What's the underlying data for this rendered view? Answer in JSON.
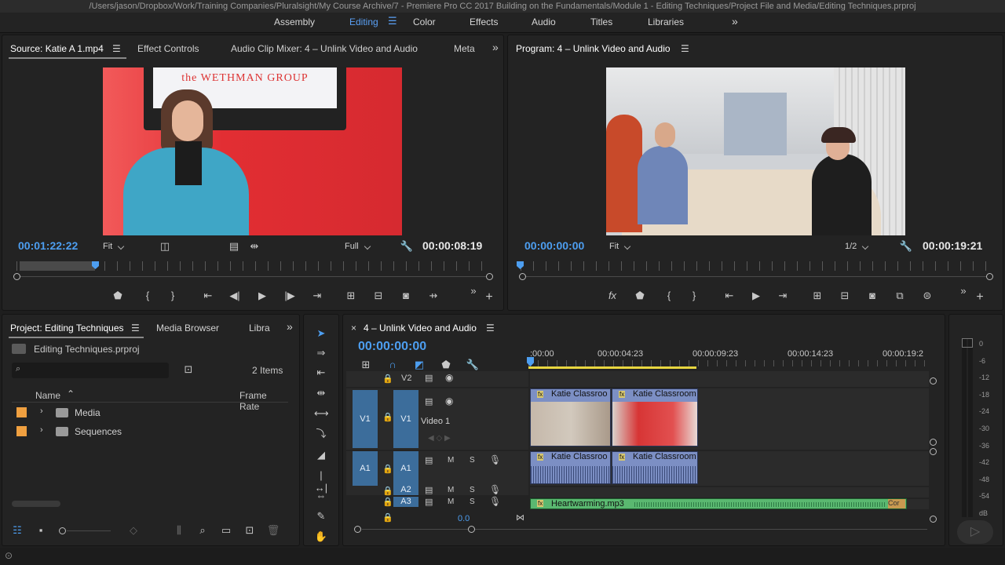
{
  "titlebar": {
    "path": "/Users/jason/Dropbox/Work/Training Companies/Pluralsight/My Course Archive/7 - Premiere Pro CC 2017 Building on the Fundamentals/Module 1 - Editing Techniques/Project File and Media/Editing Techniques.prproj"
  },
  "workspaces": {
    "items": [
      "Assembly",
      "Editing",
      "Color",
      "Effects",
      "Audio",
      "Titles",
      "Libraries"
    ],
    "active": "Editing",
    "more": "»"
  },
  "source": {
    "tabs": [
      "Source: Katie A 1.mp4",
      "Effect Controls",
      "Audio Clip Mixer: 4 – Unlink Video and Audio",
      "Meta"
    ],
    "overflow": "»",
    "timecode_current": "00:01:22:22",
    "fit": "Fit",
    "resolution": "Full",
    "timecode_duration": "00:00:08:19",
    "video_sign": "the WETHMAN GROUP"
  },
  "program": {
    "tab": "Program: 4 – Unlink Video and Audio",
    "timecode_current": "00:00:00:00",
    "fit": "Fit",
    "resolution": "1/2",
    "timecode_duration": "00:00:19:21"
  },
  "project": {
    "tabs": [
      "Project: Editing Techniques",
      "Media Browser",
      "Libra"
    ],
    "overflow": "»",
    "file": "Editing Techniques.prproj",
    "search_placeholder": "",
    "items_count": "2 Items",
    "col_name": "Name",
    "col_framerate": "Frame Rate",
    "rows": [
      {
        "name": "Media"
      },
      {
        "name": "Sequences"
      }
    ]
  },
  "timeline": {
    "close": "×",
    "tab": "4 – Unlink Video and Audio",
    "timecode": "00:00:00:00",
    "ruler": [
      ":00:00",
      "00:00:04:23",
      "00:00:09:23",
      "00:00:14:23",
      "00:00:19:2"
    ],
    "tracks": {
      "v2": "V2",
      "v1_src": "V1",
      "v1": "V1",
      "video1": "Video 1",
      "a1_src": "A1",
      "a1": "A1",
      "a2": "A2",
      "a3": "A3",
      "m": "M",
      "s": "S"
    },
    "volume": "0.0",
    "clips": {
      "v1a": "Katie Classroo",
      "v1b": "Katie Classroom",
      "a1a": "Katie Classroo",
      "a1b": "Katie Classroom",
      "a3": "Heartwarming.mp3",
      "a3end": "Cor"
    }
  },
  "meter": {
    "labels": [
      "0",
      "-6",
      "-12",
      "-18",
      "-24",
      "-30",
      "-36",
      "-42",
      "-48",
      "-54",
      "dB"
    ]
  }
}
